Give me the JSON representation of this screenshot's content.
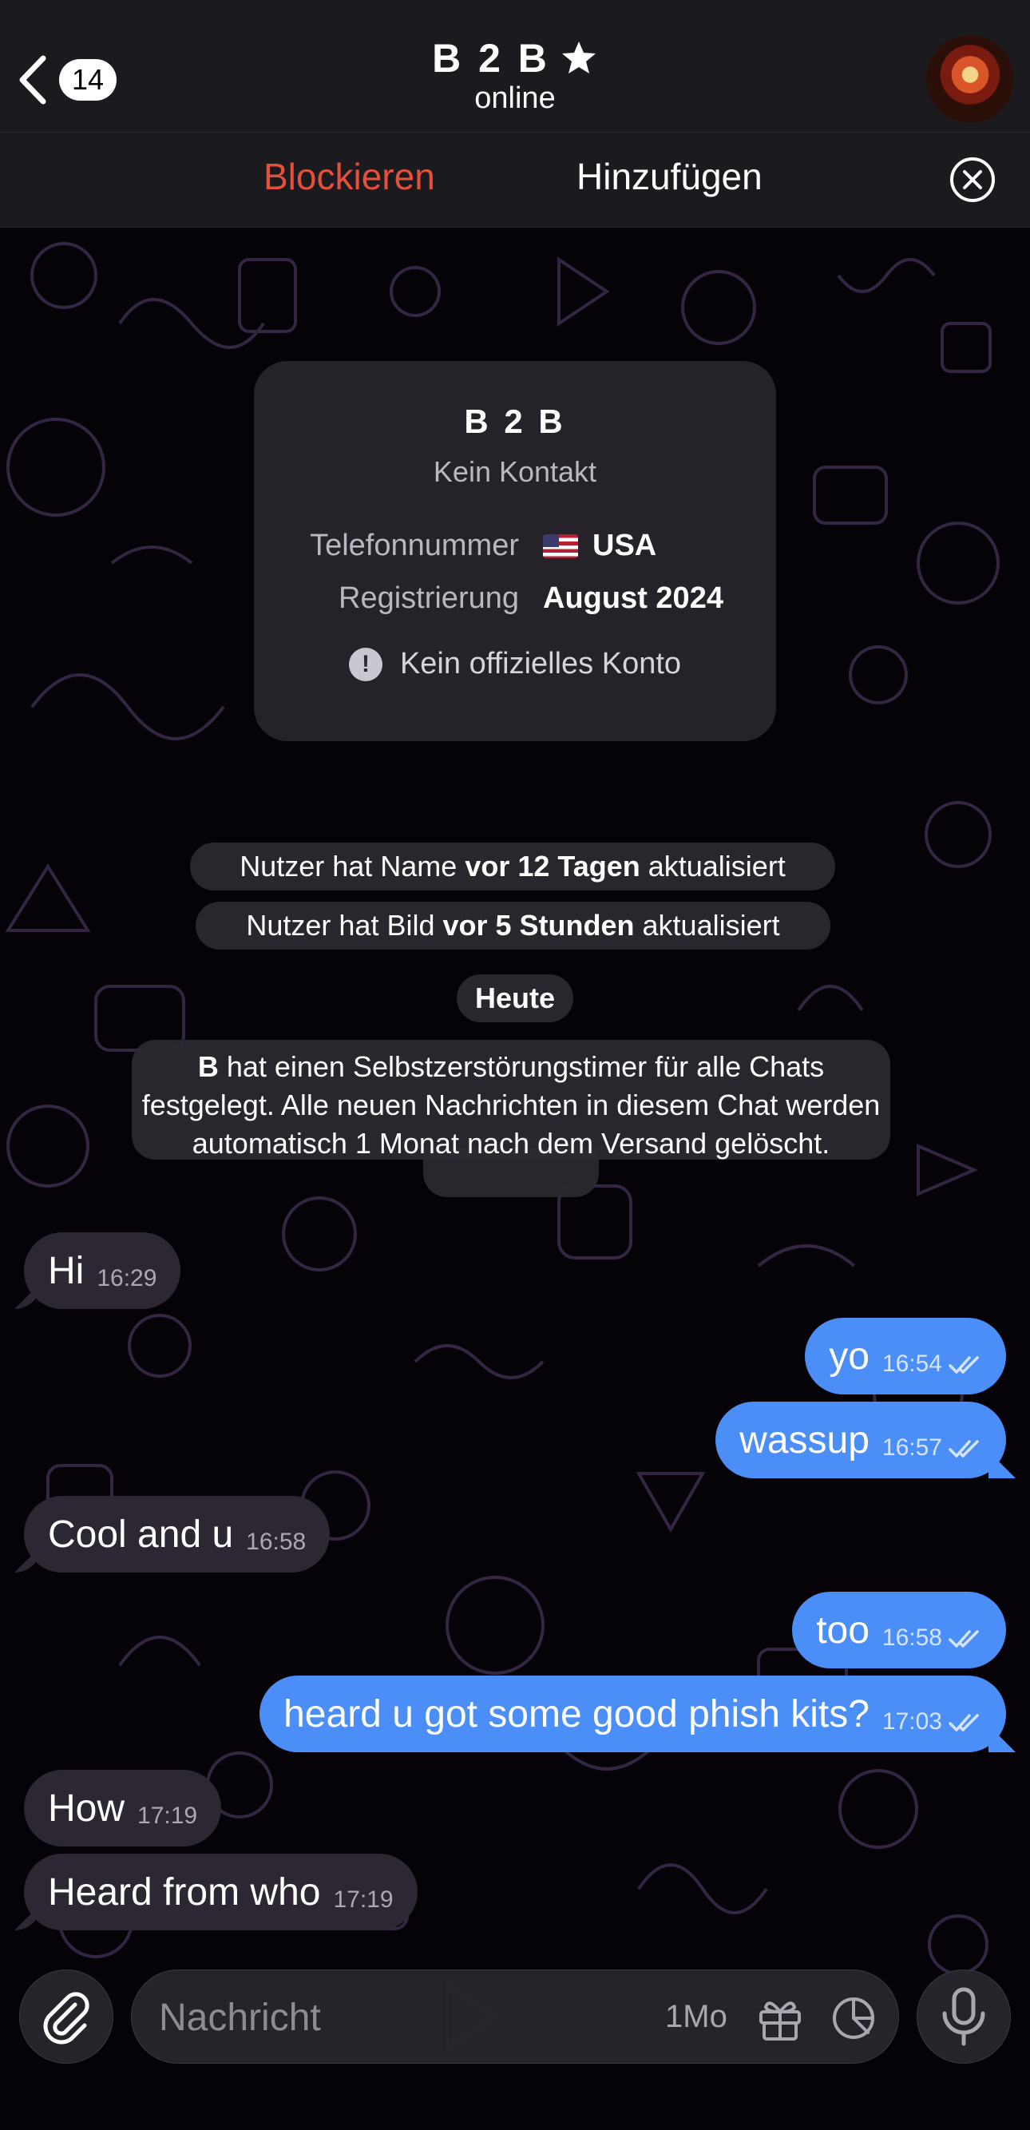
{
  "header": {
    "back_count": "14",
    "title": "B 2 B",
    "status": "online"
  },
  "actions": {
    "block": "Blockieren",
    "add": "Hinzufügen"
  },
  "info_card": {
    "name": "B 2 B",
    "subtitle": "Kein Kontakt",
    "phone_label": "Telefonnummer",
    "phone_value": "USA",
    "reg_label": "Registrierung",
    "reg_value": "August 2024",
    "warning": "Kein offizielles Konto"
  },
  "service": {
    "name_update_pre": "Nutzer hat Name ",
    "name_update_bold": "vor 12 Tagen",
    "name_update_post": " aktualisiert",
    "photo_update_pre": "Nutzer hat Bild ",
    "photo_update_bold": "vor 5 Stunden",
    "photo_update_post": " aktualisiert",
    "date": "Heute",
    "timer_bold": "B",
    "timer_text": " hat einen Selbstzerstörungstimer für alle Chats festgelegt. Alle neuen Nachrichten in diesem Chat werden automatisch 1 Monat nach dem Versand gelöscht."
  },
  "messages": [
    {
      "dir": "in",
      "text": "Hi",
      "time": "16:29"
    },
    {
      "dir": "out",
      "text": "yo",
      "time": "16:54"
    },
    {
      "dir": "out",
      "text": "wassup",
      "time": "16:57"
    },
    {
      "dir": "in",
      "text": "Cool and u",
      "time": "16:58"
    },
    {
      "dir": "out",
      "text": "too",
      "time": "16:58"
    },
    {
      "dir": "out",
      "text": "heard u got some good phish kits?",
      "time": "17:03"
    },
    {
      "dir": "in",
      "text": "How",
      "time": "17:19"
    },
    {
      "dir": "in",
      "text": "Heard from who",
      "time": "17:19"
    }
  ],
  "input": {
    "placeholder": "Nachricht",
    "timer": "1Mo"
  },
  "colors": {
    "outgoing": "#4b8ef7",
    "incoming": "#2c2733",
    "block": "#e4503a"
  }
}
